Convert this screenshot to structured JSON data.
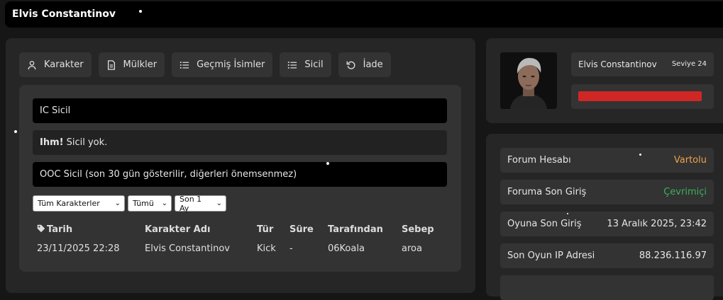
{
  "header": {
    "title": "Elvis Constantinov"
  },
  "tabs": [
    {
      "label": "Karakter",
      "icon": "user-icon"
    },
    {
      "label": "Mülkler",
      "icon": "document-icon"
    },
    {
      "label": "Geçmiş İsimler",
      "icon": "list-icon"
    },
    {
      "label": "Sicil",
      "icon": "list-icon"
    },
    {
      "label": "İade",
      "icon": "refresh-icon"
    }
  ],
  "record": {
    "ic_title": "IC Sicil",
    "empty_prefix": "Ihm!",
    "empty_text": "Sicil yok.",
    "ooc_title": "OOC Sicil (son 30 gün gösterilir, diğerleri önemsenmez)",
    "filters": {
      "character": "Tüm Karakterler",
      "type": "Tümü",
      "period": "Son 1 Ay"
    },
    "columns": [
      "Tarih",
      "Karakter Adı",
      "Tür",
      "Süre",
      "Tarafından",
      "Sebep"
    ],
    "rows": [
      [
        "23/11/2025 22:28",
        "Elvis Constantinov",
        "Kick",
        "-",
        "06Koala",
        "aroa"
      ]
    ]
  },
  "profile": {
    "name": "Elvis Constantinov",
    "level": "Seviye 24",
    "health_fraction": 1.0,
    "health_color": "#d02626"
  },
  "info": [
    {
      "label": "Forum Hesabı",
      "value": "Vartolu",
      "color": "#f0a04b"
    },
    {
      "label": "Foruma Son Giriş",
      "value": "Çevrimiçi",
      "color": "#3cb15c"
    },
    {
      "label": "Oyuna Son Giriş",
      "value": "13 Aralık 2025, 23:42",
      "color": "#e6e6e6"
    },
    {
      "label": "Son Oyun IP Adresi",
      "value": "88.236.116.97",
      "color": "#e6e6e6"
    }
  ]
}
